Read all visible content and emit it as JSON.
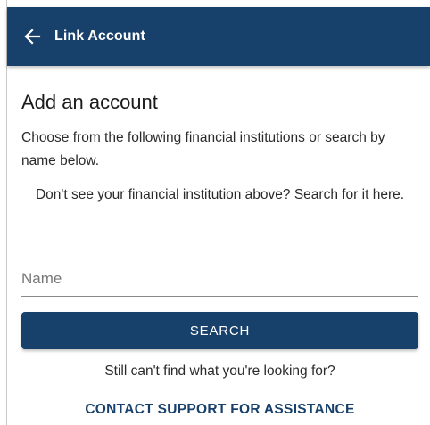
{
  "header": {
    "title": "Link Account",
    "back_icon": "arrow-left-icon",
    "background_color": "#17406b"
  },
  "main": {
    "heading": "Add an account",
    "intro": "Choose from the following financial institutions or search by name below.",
    "not_found_text": "Don't see your financial institution above? Search for it here.",
    "name_field": {
      "placeholder": "Name",
      "value": ""
    },
    "search_button_label": "SEARCH",
    "still_text": "Still can't find what you're looking for?",
    "contact_support_label": "CONTACT SUPPORT FOR ASSISTANCE"
  },
  "colors": {
    "primary": "#17406b",
    "text": "#2a2a2a"
  }
}
